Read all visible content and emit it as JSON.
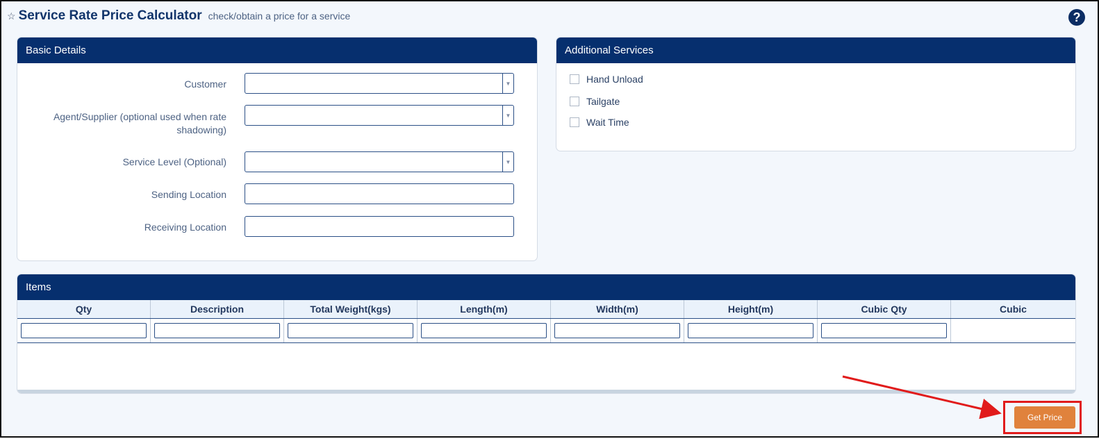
{
  "header": {
    "title": "Service Rate Price Calculator",
    "subtitle": "check/obtain a price for a service",
    "help": "?"
  },
  "basic_details": {
    "title": "Basic Details",
    "fields": [
      {
        "label": "Customer",
        "type": "select",
        "value": ""
      },
      {
        "label": "Agent/Supplier (optional used when rate shadowing)",
        "type": "select",
        "value": ""
      },
      {
        "label": "Service Level (Optional)",
        "type": "select",
        "value": ""
      },
      {
        "label": "Sending Location",
        "type": "text",
        "value": ""
      },
      {
        "label": "Receiving Location",
        "type": "text",
        "value": ""
      }
    ]
  },
  "additional_services": {
    "title": "Additional Services",
    "options": [
      {
        "label": "Hand Unload",
        "checked": false
      },
      {
        "label": "Tailgate",
        "checked": false
      },
      {
        "label": "Wait Time",
        "checked": false
      }
    ]
  },
  "items": {
    "title": "Items",
    "columns": [
      "Qty",
      "Description",
      "Total Weight(kgs)",
      "Length(m)",
      "Width(m)",
      "Height(m)",
      "Cubic Qty",
      "Cubic"
    ]
  },
  "actions": {
    "get_price": "Get Price"
  },
  "colors": {
    "panel_header": "#062f6e",
    "button": "#e0823c",
    "highlight": "#e11b1b"
  },
  "icons": {
    "favorite": "star-icon",
    "help": "question-circle-icon",
    "dropdown": "chevron-down-icon"
  }
}
